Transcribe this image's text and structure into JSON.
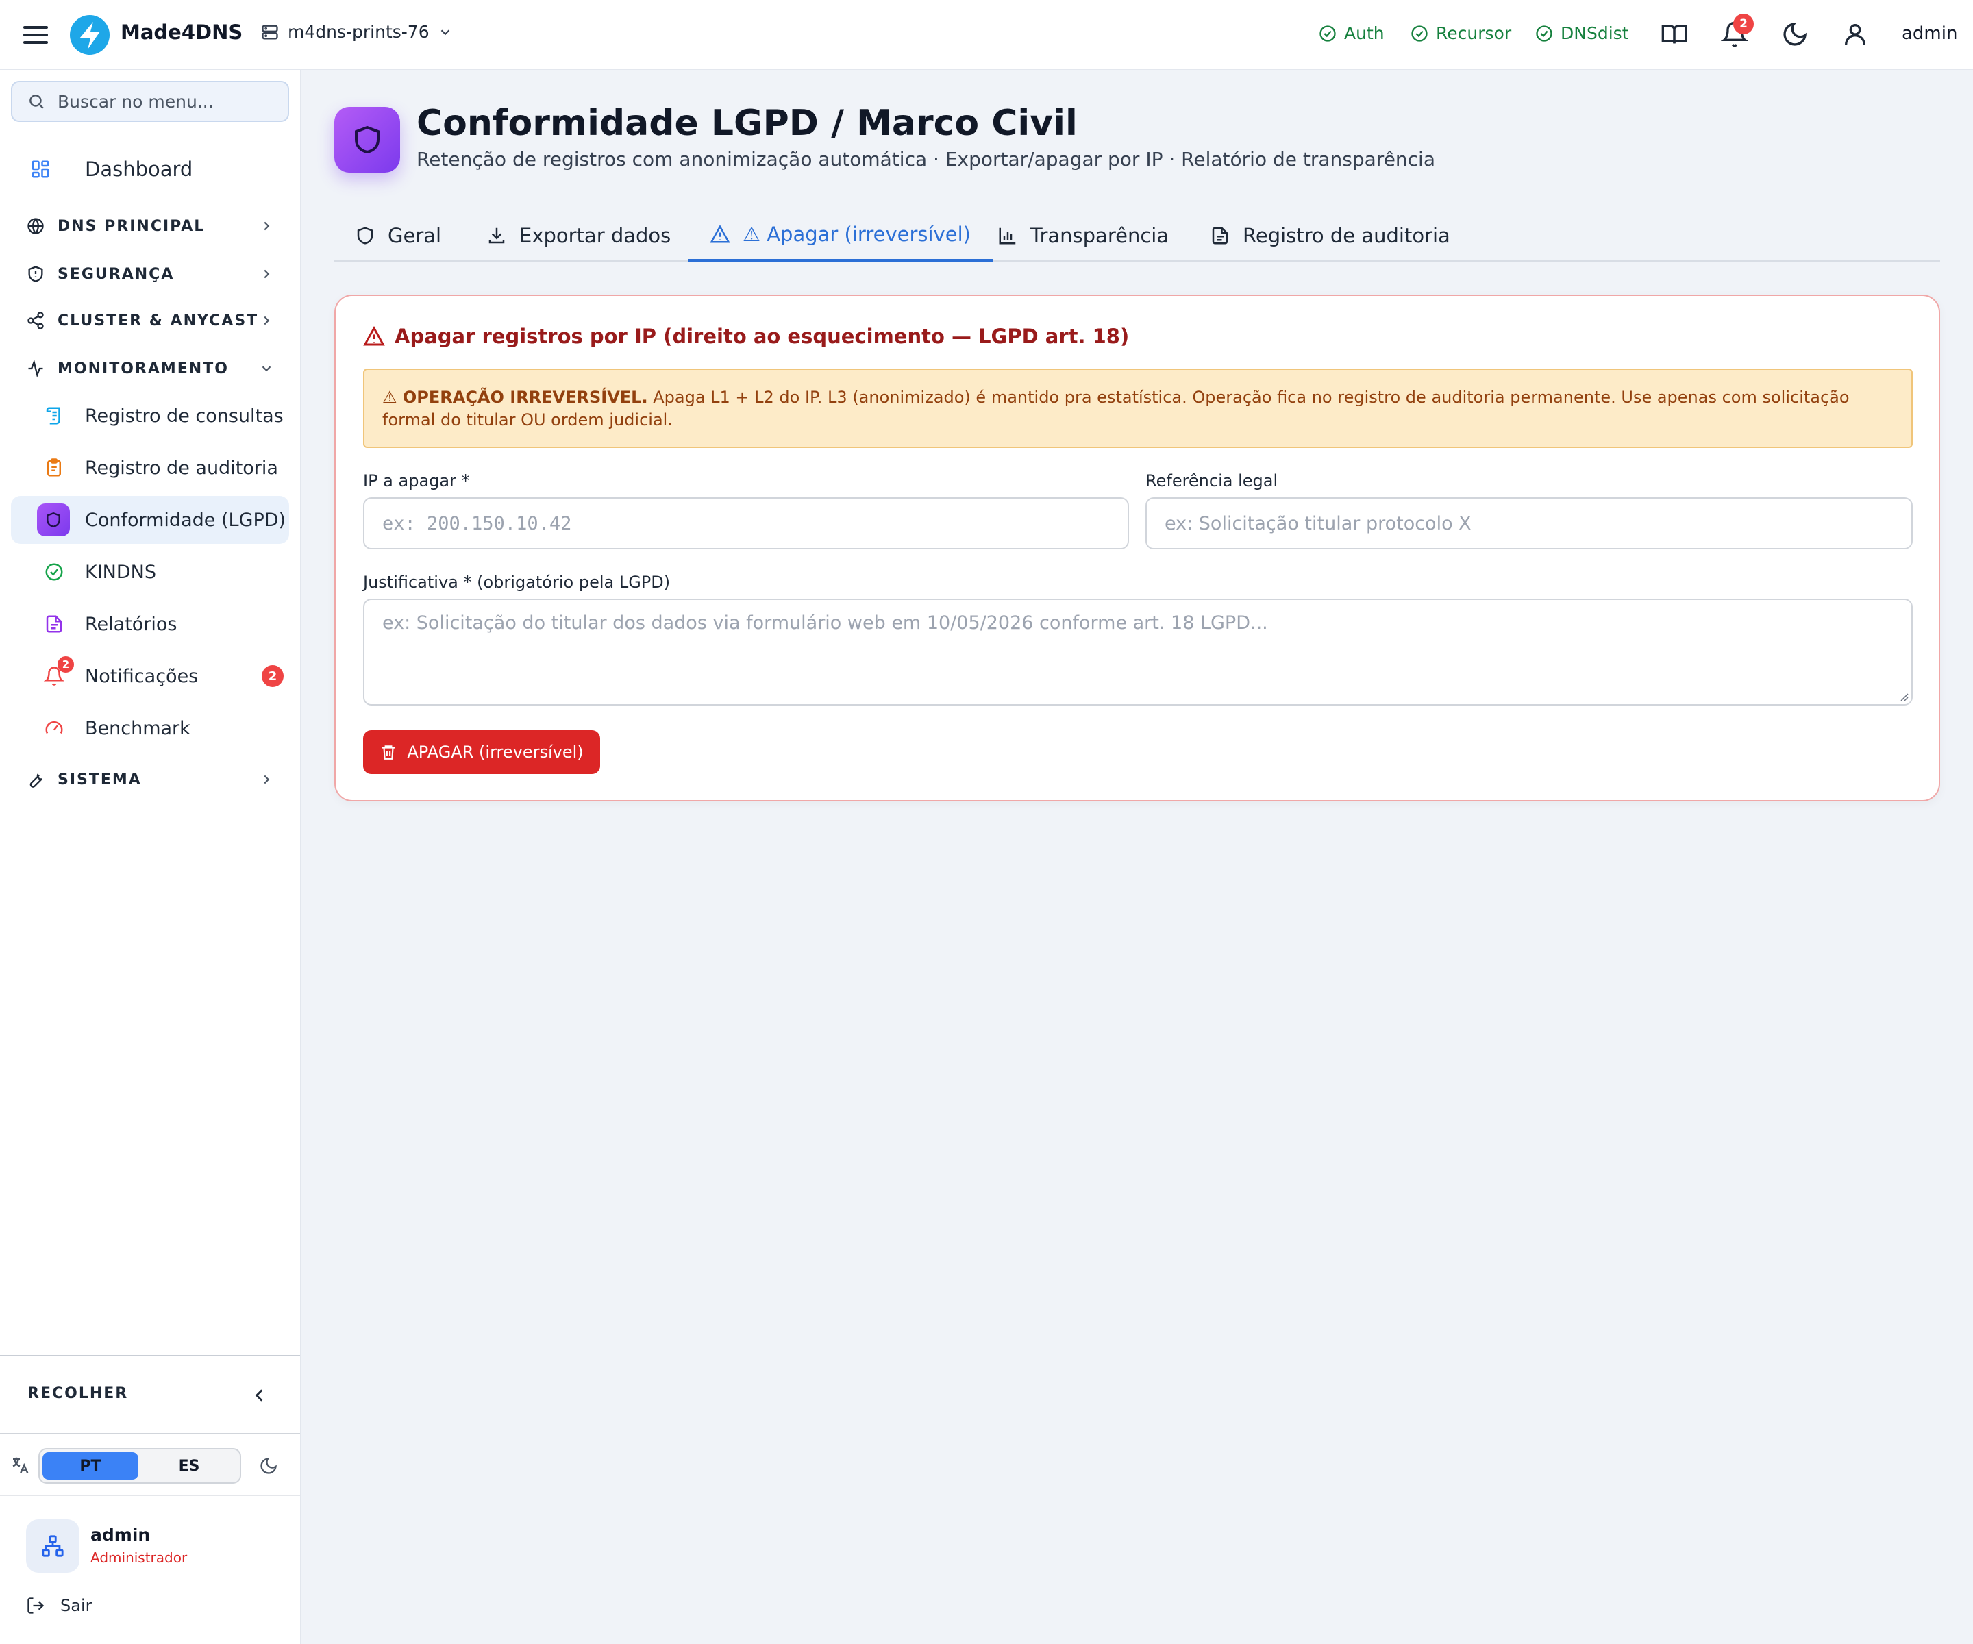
{
  "app": {
    "brand": "Made4DNS",
    "server": "m4dns-prints-76"
  },
  "topbar": {
    "statuses": [
      "Auth",
      "Recursor",
      "DNSdist"
    ],
    "notifications_count": "2",
    "user": "admin"
  },
  "sidebar": {
    "search_placeholder": "Buscar no menu...",
    "dashboard": "Dashboard",
    "sections": {
      "dns": "DNS PRINCIPAL",
      "security": "SEGURANÇA",
      "cluster": "CLUSTER & ANYCAST",
      "monitoring": "MONITORAMENTO",
      "system": "SISTEMA"
    },
    "monitoring_items": [
      "Registro de consultas",
      "Registro de auditoria",
      "Conformidade (LGPD)",
      "KINDNS",
      "Relatórios",
      "Notificações",
      "Benchmark"
    ],
    "notifications_badge": "2",
    "collapse_label": "RECOLHER",
    "lang": {
      "pt": "PT",
      "es": "ES",
      "selected": "PT"
    },
    "user": {
      "name": "admin",
      "role": "Administrador"
    },
    "logout": "Sair"
  },
  "page": {
    "title": "Conformidade LGPD / Marco Civil",
    "subtitle": "Retenção de registros com anonimização automática · Exportar/apagar por IP · Relatório de transparência",
    "tabs": [
      "Geral",
      "Exportar dados",
      "⚠ Apagar (irreversível)",
      "Transparência",
      "Registro de auditoria"
    ],
    "active_tab": "⚠ Apagar (irreversível)"
  },
  "erase_card": {
    "title": "Apagar registros por IP (direito ao esquecimento — LGPD art. 18)",
    "warning_strong": "⚠ OPERAÇÃO IRREVERSÍVEL.",
    "warning_text": " Apaga L1 + L2 do IP. L3 (anonimizado) é mantido pra estatística. Operação fica no registro de auditoria permanente. Use apenas com solicitação formal do titular OU ordem judicial.",
    "ip_label": "IP a apagar *",
    "ip_placeholder": "ex: 200.150.10.42",
    "ref_label": "Referência legal",
    "ref_placeholder": "ex: Solicitação titular protocolo X",
    "just_label": "Justificativa * (obrigatório pela LGPD)",
    "just_placeholder": "ex: Solicitação do titular dos dados via formulário web em 10/05/2026 conforme art. 18 LGPD...",
    "button": "APAGAR (irreversível)"
  }
}
